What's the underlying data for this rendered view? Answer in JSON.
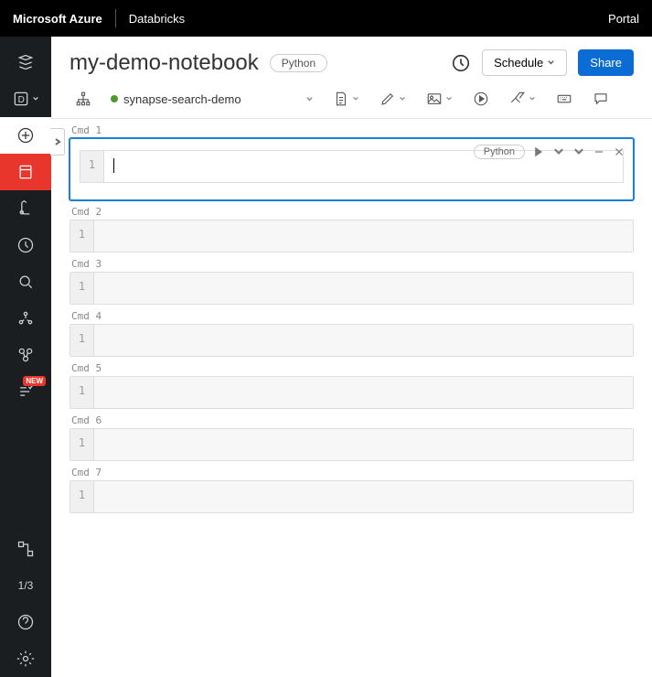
{
  "topbar": {
    "brand": "Microsoft Azure",
    "product": "Databricks",
    "portal": "Portal"
  },
  "sidebar": {
    "badge_new": "NEW",
    "page_label": "1/3"
  },
  "header": {
    "title": "my-demo-notebook",
    "language": "Python",
    "schedule": "Schedule",
    "share": "Share"
  },
  "toolbar": {
    "attached_cluster": "synapse-search-demo"
  },
  "cells": [
    {
      "label": "Cmd 1",
      "line": "1",
      "lang": "Python",
      "active": true
    },
    {
      "label": "Cmd 2",
      "line": "1",
      "active": false
    },
    {
      "label": "Cmd 3",
      "line": "1",
      "active": false
    },
    {
      "label": "Cmd 4",
      "line": "1",
      "active": false
    },
    {
      "label": "Cmd 5",
      "line": "1",
      "active": false
    },
    {
      "label": "Cmd 6",
      "line": "1",
      "active": false
    },
    {
      "label": "Cmd 7",
      "line": "1",
      "active": false
    }
  ]
}
